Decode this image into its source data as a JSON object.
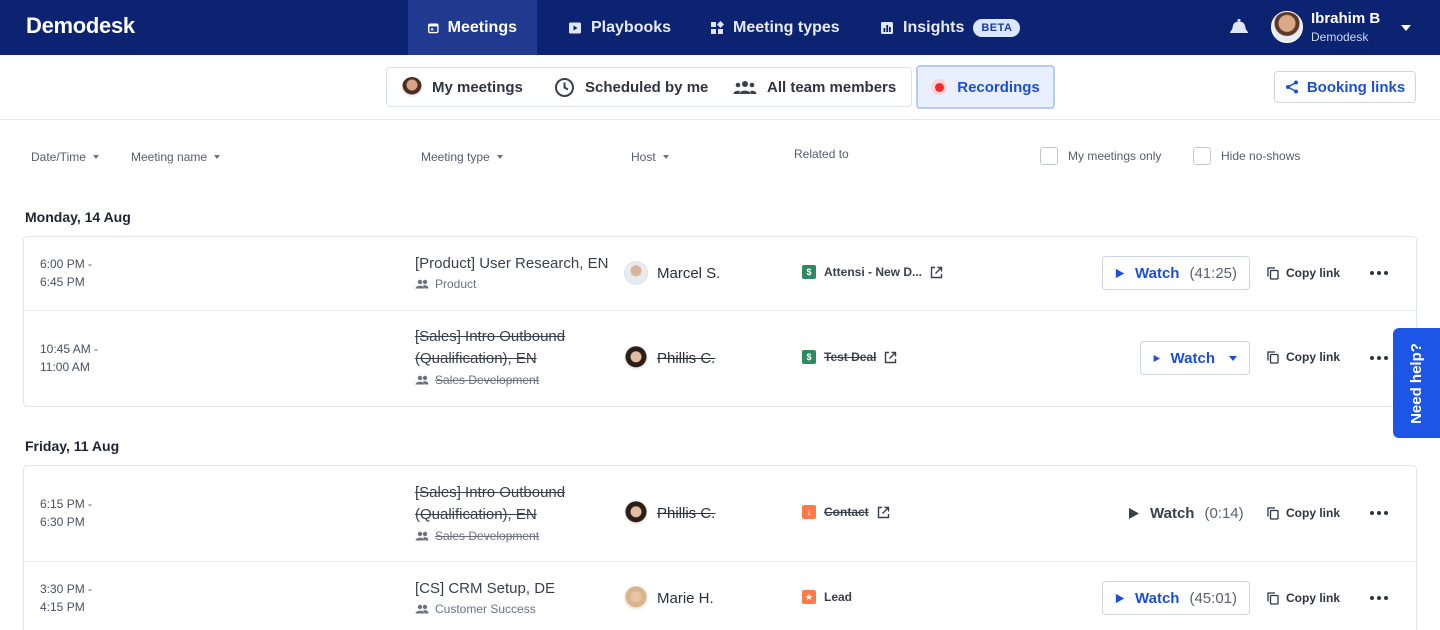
{
  "app": {
    "logo": "Demodesk"
  },
  "nav": {
    "tabs": [
      {
        "label": "Meetings",
        "icon": "calendar-icon",
        "active": true
      },
      {
        "label": "Playbooks",
        "icon": "play-square-icon"
      },
      {
        "label": "Meeting types",
        "icon": "grid-icon"
      },
      {
        "label": "Insights",
        "icon": "chart-icon",
        "badge": "BETA"
      }
    ]
  },
  "user": {
    "name": "Ibrahim B",
    "org": "Demodesk"
  },
  "subnav": {
    "tabs": [
      {
        "label": "My meetings",
        "icon": "person-avatar"
      },
      {
        "label": "Scheduled by me",
        "icon": "clock-icon"
      },
      {
        "label": "All team members",
        "icon": "team-icon"
      }
    ],
    "recordings": "Recordings",
    "booking_links": "Booking links"
  },
  "filters": {
    "date_time": "Date/Time",
    "meeting_name": "Meeting name",
    "meeting_type": "Meeting type",
    "host": "Host",
    "related_to": "Related to",
    "my_meetings_only": "My meetings only",
    "hide_no_shows": "Hide no-shows"
  },
  "days": [
    {
      "label": "Monday, 14 Aug",
      "meetings": [
        {
          "start": "6:00 PM -",
          "end": "6:45 PM",
          "title": "[Product] User Research, EN",
          "type": "Product",
          "host": "Marcel S.",
          "related": "Attensi - New D...",
          "watch": "Watch",
          "duration": "(41:25)",
          "copy": "Copy link"
        },
        {
          "start": "10:45 AM -",
          "end": "11:00 AM",
          "title_l1": "[Sales] Intro Outbound",
          "title_l2": "(Qualification), EN",
          "type": "Sales Development",
          "host": "Phillis C.",
          "related": "Test Deal",
          "watch": "Watch",
          "copy": "Copy link"
        }
      ]
    },
    {
      "label": "Friday, 11 Aug",
      "meetings": [
        {
          "start": "6:15 PM -",
          "end": "6:30 PM",
          "title_l1": "[Sales] Intro Outbound",
          "title_l2": "(Qualification), EN",
          "type": "Sales Development",
          "host": "Phillis C.",
          "related": "Contact",
          "watch": "Watch",
          "duration": "(0:14)",
          "copy": "Copy link"
        },
        {
          "start": "3:30 PM -",
          "end": "4:15 PM",
          "title": "[CS] CRM Setup, DE",
          "type": "Customer Success",
          "host": "Marie H.",
          "related": "Lead",
          "watch": "Watch",
          "duration": "(45:01)",
          "copy": "Copy link"
        }
      ]
    }
  ],
  "help": "Need help?",
  "colors": {
    "nav_bg": "#0c2372",
    "accent": "#1d4ed8",
    "record": "#ee2b2b",
    "help_bg": "#1d55e6"
  }
}
